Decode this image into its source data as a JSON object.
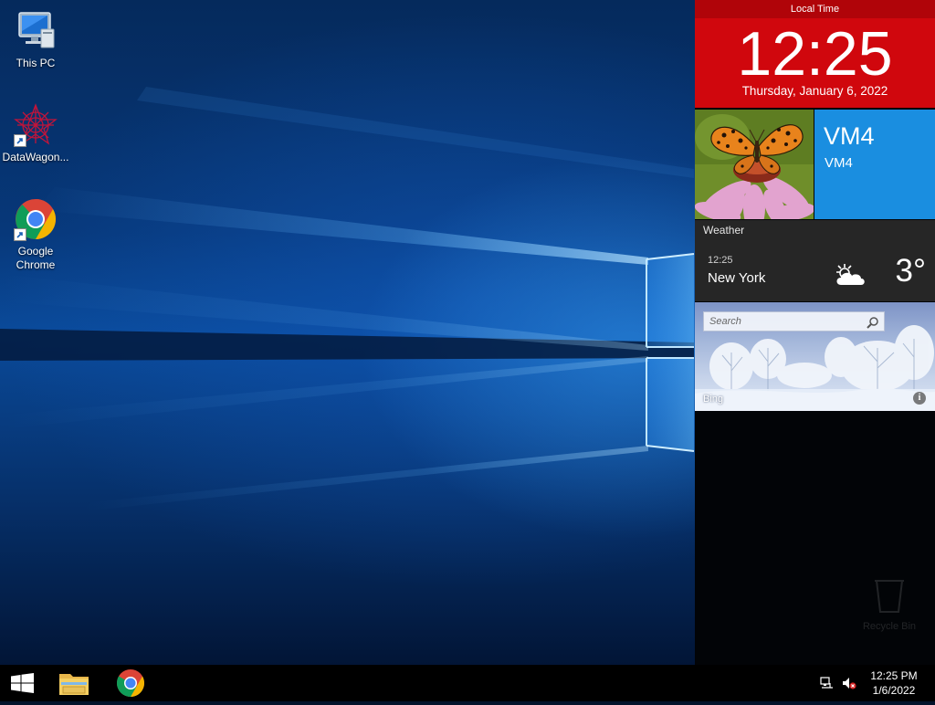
{
  "desktop": {
    "icons": [
      {
        "label": "This PC",
        "icon": "this-pc-icon"
      },
      {
        "label": "DataWagon...",
        "icon": "datawagon-icon"
      },
      {
        "label": "Google Chrome",
        "icon": "chrome-icon"
      }
    ]
  },
  "panel": {
    "clock": {
      "header": "Local Time",
      "time": "12:25",
      "date": "Thursday, January 6, 2022"
    },
    "photo_tile": {
      "icon": "butterfly-photo"
    },
    "vm_tile": {
      "title": "VM4",
      "subtitle": "VM4",
      "color": "#1a8ee0"
    },
    "weather": {
      "title": "Weather",
      "time": "12:25",
      "city": "New York",
      "temperature": "3°",
      "icon": "partly-cloudy-icon"
    },
    "bing": {
      "search_placeholder": "Search",
      "label": "Bing",
      "info_glyph": "i"
    },
    "ghost_recycle_bin": {
      "label": "Recycle Bin"
    }
  },
  "taskbar": {
    "pinned": [
      {
        "name": "start",
        "icon": "windows-logo-icon"
      },
      {
        "name": "file-explorer",
        "icon": "folder-icon"
      },
      {
        "name": "chrome",
        "icon": "chrome-icon"
      }
    ],
    "tray": {
      "network_icon": "network-icon",
      "volume_icon": "volume-muted-icon",
      "time": "12:25 PM",
      "date": "1/6/2022"
    }
  },
  "colors": {
    "clock_tile": "#d0070d",
    "vm_tile": "#1a8ee0",
    "weather_tile": "#262626",
    "taskbar": "#000000"
  }
}
